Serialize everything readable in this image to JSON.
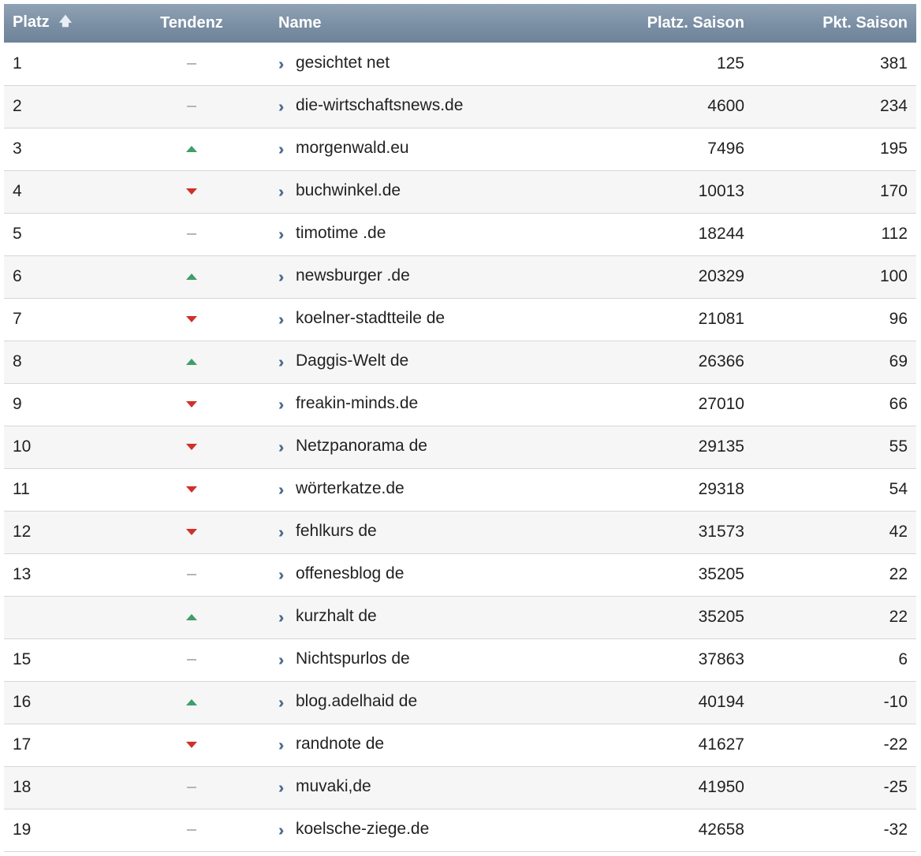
{
  "colors": {
    "header_bg": "#7b8fa4",
    "up": "#3f9e6a",
    "down": "#d0302b",
    "same": "#b5b5b5",
    "link_icon": "#4a6b8d"
  },
  "table": {
    "columns": {
      "platz": "Platz",
      "tendenz": "Tendenz",
      "name": "Name",
      "platz_saison": "Platz. Saison",
      "pkt_saison": "Pkt. Saison"
    },
    "sort_icon": "sort-up-arrow-icon",
    "rows": [
      {
        "platz": "1",
        "trend": "same",
        "name": "gesichtet net",
        "platz_saison": "125",
        "pkt_saison": "381"
      },
      {
        "platz": "2",
        "trend": "same",
        "name": "die-wirtschaftsnews.de",
        "platz_saison": "4600",
        "pkt_saison": "234"
      },
      {
        "platz": "3",
        "trend": "up",
        "name": "morgenwald.eu",
        "platz_saison": "7496",
        "pkt_saison": "195"
      },
      {
        "platz": "4",
        "trend": "down",
        "name": "buchwinkel.de",
        "platz_saison": "10013",
        "pkt_saison": "170"
      },
      {
        "platz": "5",
        "trend": "same",
        "name": "timotime .de",
        "platz_saison": "18244",
        "pkt_saison": "112"
      },
      {
        "platz": "6",
        "trend": "up",
        "name": "newsburger .de",
        "platz_saison": "20329",
        "pkt_saison": "100"
      },
      {
        "platz": "7",
        "trend": "down",
        "name": "koelner-stadtteile de",
        "platz_saison": "21081",
        "pkt_saison": "96"
      },
      {
        "platz": "8",
        "trend": "up",
        "name": "Daggis-Welt de",
        "platz_saison": "26366",
        "pkt_saison": "69"
      },
      {
        "platz": "9",
        "trend": "down",
        "name": "freakin-minds.de",
        "platz_saison": "27010",
        "pkt_saison": "66"
      },
      {
        "platz": "10",
        "trend": "down",
        "name": "Netzpanorama de",
        "platz_saison": "29135",
        "pkt_saison": "55"
      },
      {
        "platz": "11",
        "trend": "down",
        "name": "wörterkatze.de",
        "platz_saison": "29318",
        "pkt_saison": "54"
      },
      {
        "platz": "12",
        "trend": "down",
        "name": "fehlkurs de",
        "platz_saison": "31573",
        "pkt_saison": "42"
      },
      {
        "platz": "13",
        "trend": "same",
        "name": "offenesblog de",
        "platz_saison": "35205",
        "pkt_saison": "22"
      },
      {
        "platz": "",
        "trend": "up",
        "name": "kurzhalt de",
        "platz_saison": "35205",
        "pkt_saison": "22"
      },
      {
        "platz": "15",
        "trend": "same",
        "name": "Nichtspurlos de",
        "platz_saison": "37863",
        "pkt_saison": "6"
      },
      {
        "platz": "16",
        "trend": "up",
        "name": "blog.adelhaid de",
        "platz_saison": "40194",
        "pkt_saison": "-10"
      },
      {
        "platz": "17",
        "trend": "down",
        "name": "randnote de",
        "platz_saison": "41627",
        "pkt_saison": "-22"
      },
      {
        "platz": "18",
        "trend": "same",
        "name": "muvaki,de",
        "platz_saison": "41950",
        "pkt_saison": "-25"
      },
      {
        "platz": "19",
        "trend": "same",
        "name": "koelsche-ziege.de",
        "platz_saison": "42658",
        "pkt_saison": "-32"
      }
    ]
  }
}
